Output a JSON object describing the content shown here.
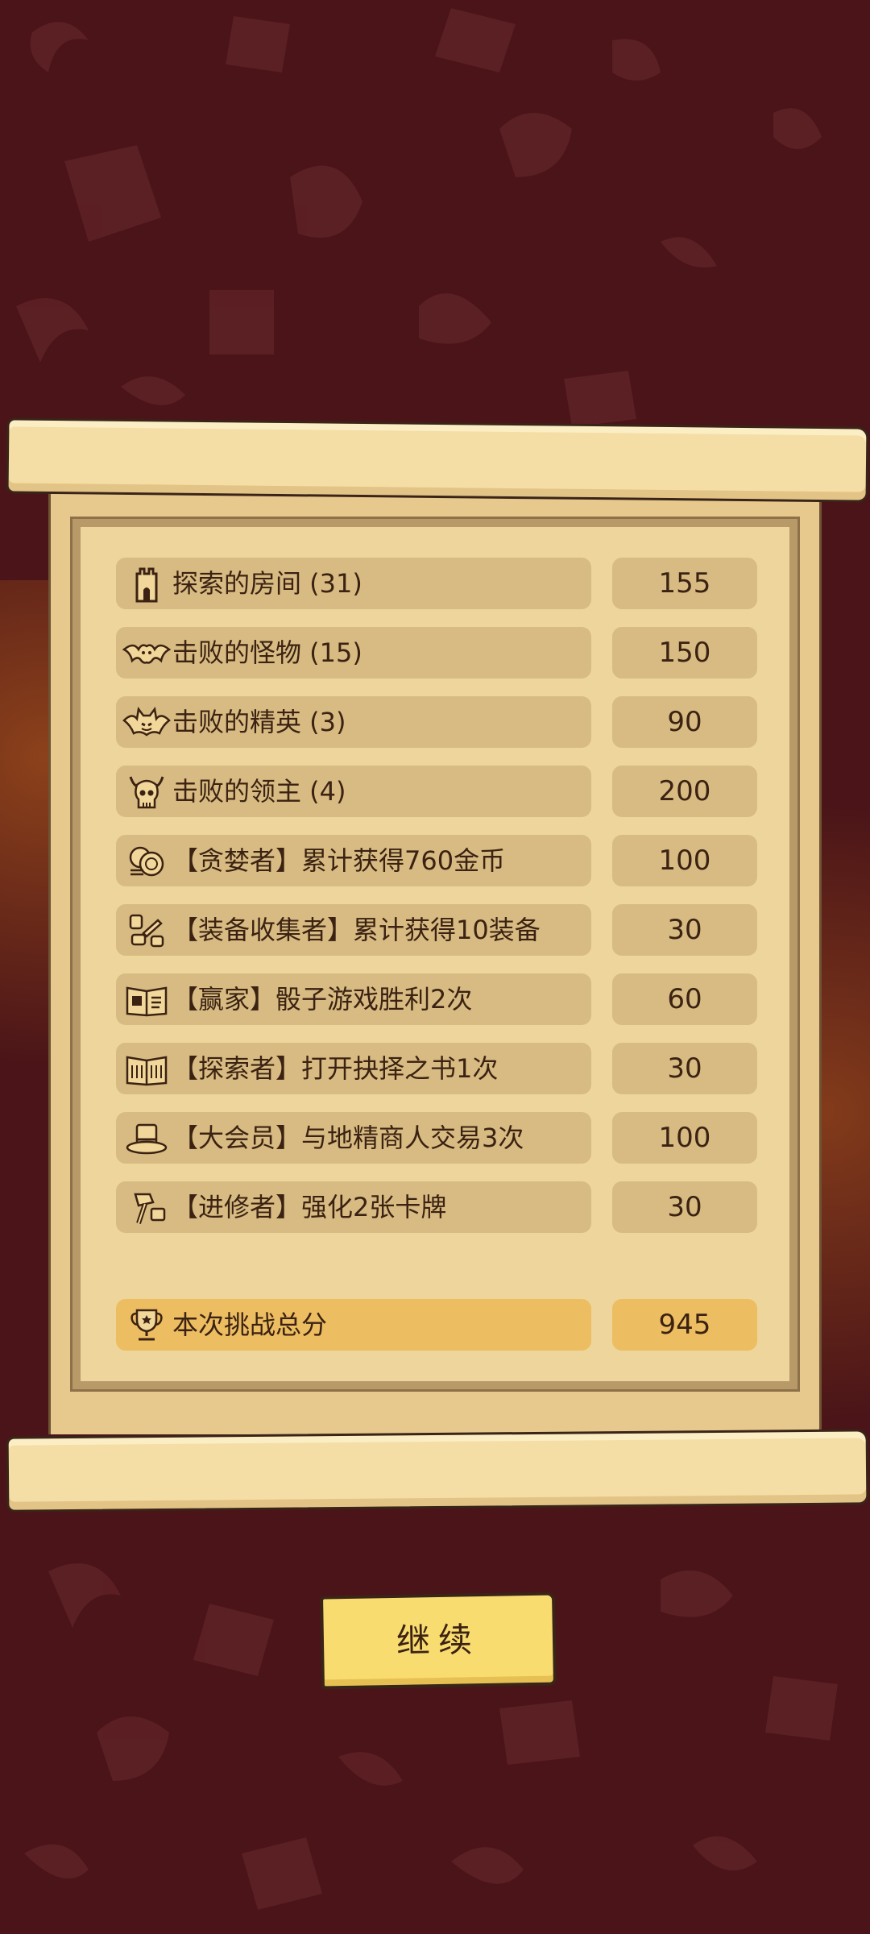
{
  "results": {
    "rows": [
      {
        "icon": "tower-icon",
        "label": "探索的房间 (31)",
        "value": "155"
      },
      {
        "icon": "bat-icon",
        "label": "击败的怪物 (15)",
        "value": "150"
      },
      {
        "icon": "demon-bat-icon",
        "label": "击败的精英 (3)",
        "value": "90"
      },
      {
        "icon": "horned-skull-icon",
        "label": "击败的领主 (4)",
        "value": "200"
      },
      {
        "icon": "coin-stack-icon",
        "label": "【贪婪者】累计获得760金币",
        "value": "100"
      },
      {
        "icon": "equipment-icon",
        "label": "【装备收集者】累计获得10装备",
        "value": "30"
      },
      {
        "icon": "dice-book-icon",
        "label": "【赢家】骰子游戏胜利2次",
        "value": "60"
      },
      {
        "icon": "open-book-icon",
        "label": "【探索者】打开抉择之书1次",
        "value": "30"
      },
      {
        "icon": "top-hat-icon",
        "label": "【大会员】与地精商人交易3次",
        "value": "100"
      },
      {
        "icon": "hammer-icon",
        "label": "【进修者】强化2张卡牌",
        "value": "30"
      }
    ],
    "total": {
      "icon": "trophy-icon",
      "label": "本次挑战总分",
      "value": "945"
    }
  },
  "continue_button": {
    "label": "继续"
  },
  "colors": {
    "background": "#4a1418",
    "parchment": "#e7c98d",
    "row_fill": "#d7bb82",
    "total_fill": "#ecbd61",
    "button_fill": "#f8dc70",
    "text": "#3b2212"
  }
}
